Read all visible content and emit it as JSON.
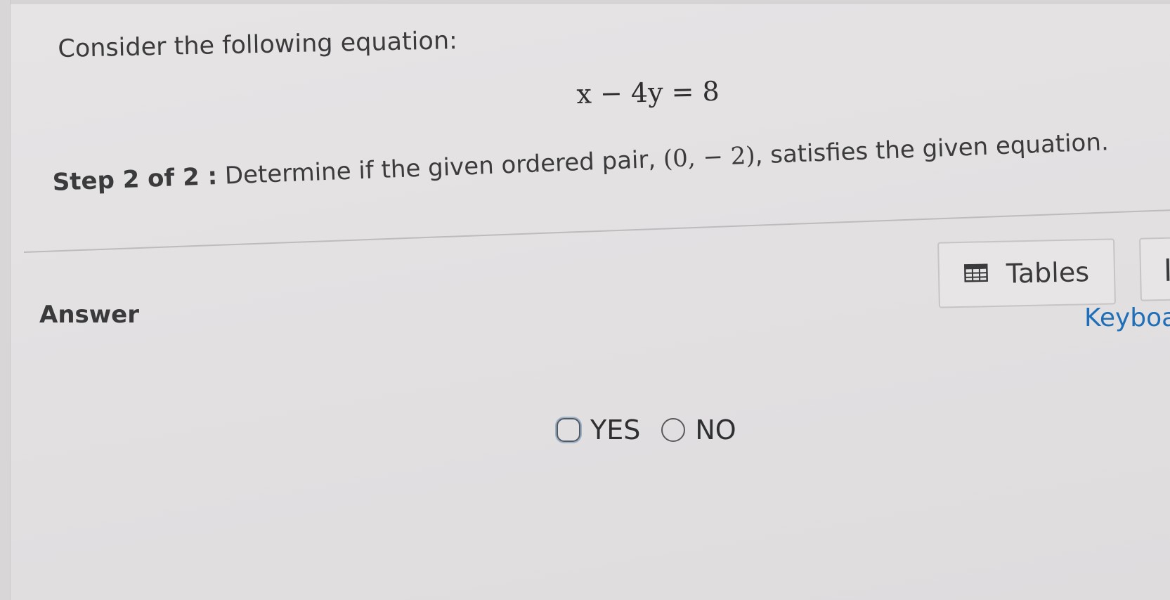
{
  "question": {
    "prompt": "Consider the following equation:",
    "equation": "x − 4y = 8",
    "step_label": "Step 2 of 2 :",
    "step_text": "Determine if the given ordered pair,",
    "ordered_pair": "(0, − 2)",
    "step_text_end": ", satisfies the given equation."
  },
  "answer": {
    "label": "Answer",
    "tables_button_label": "Tables",
    "keyboard_link_label": "Keyboa",
    "options": [
      {
        "label": "YES"
      },
      {
        "label": "NO"
      }
    ]
  },
  "icons": {
    "tables": "table-grid-icon"
  }
}
